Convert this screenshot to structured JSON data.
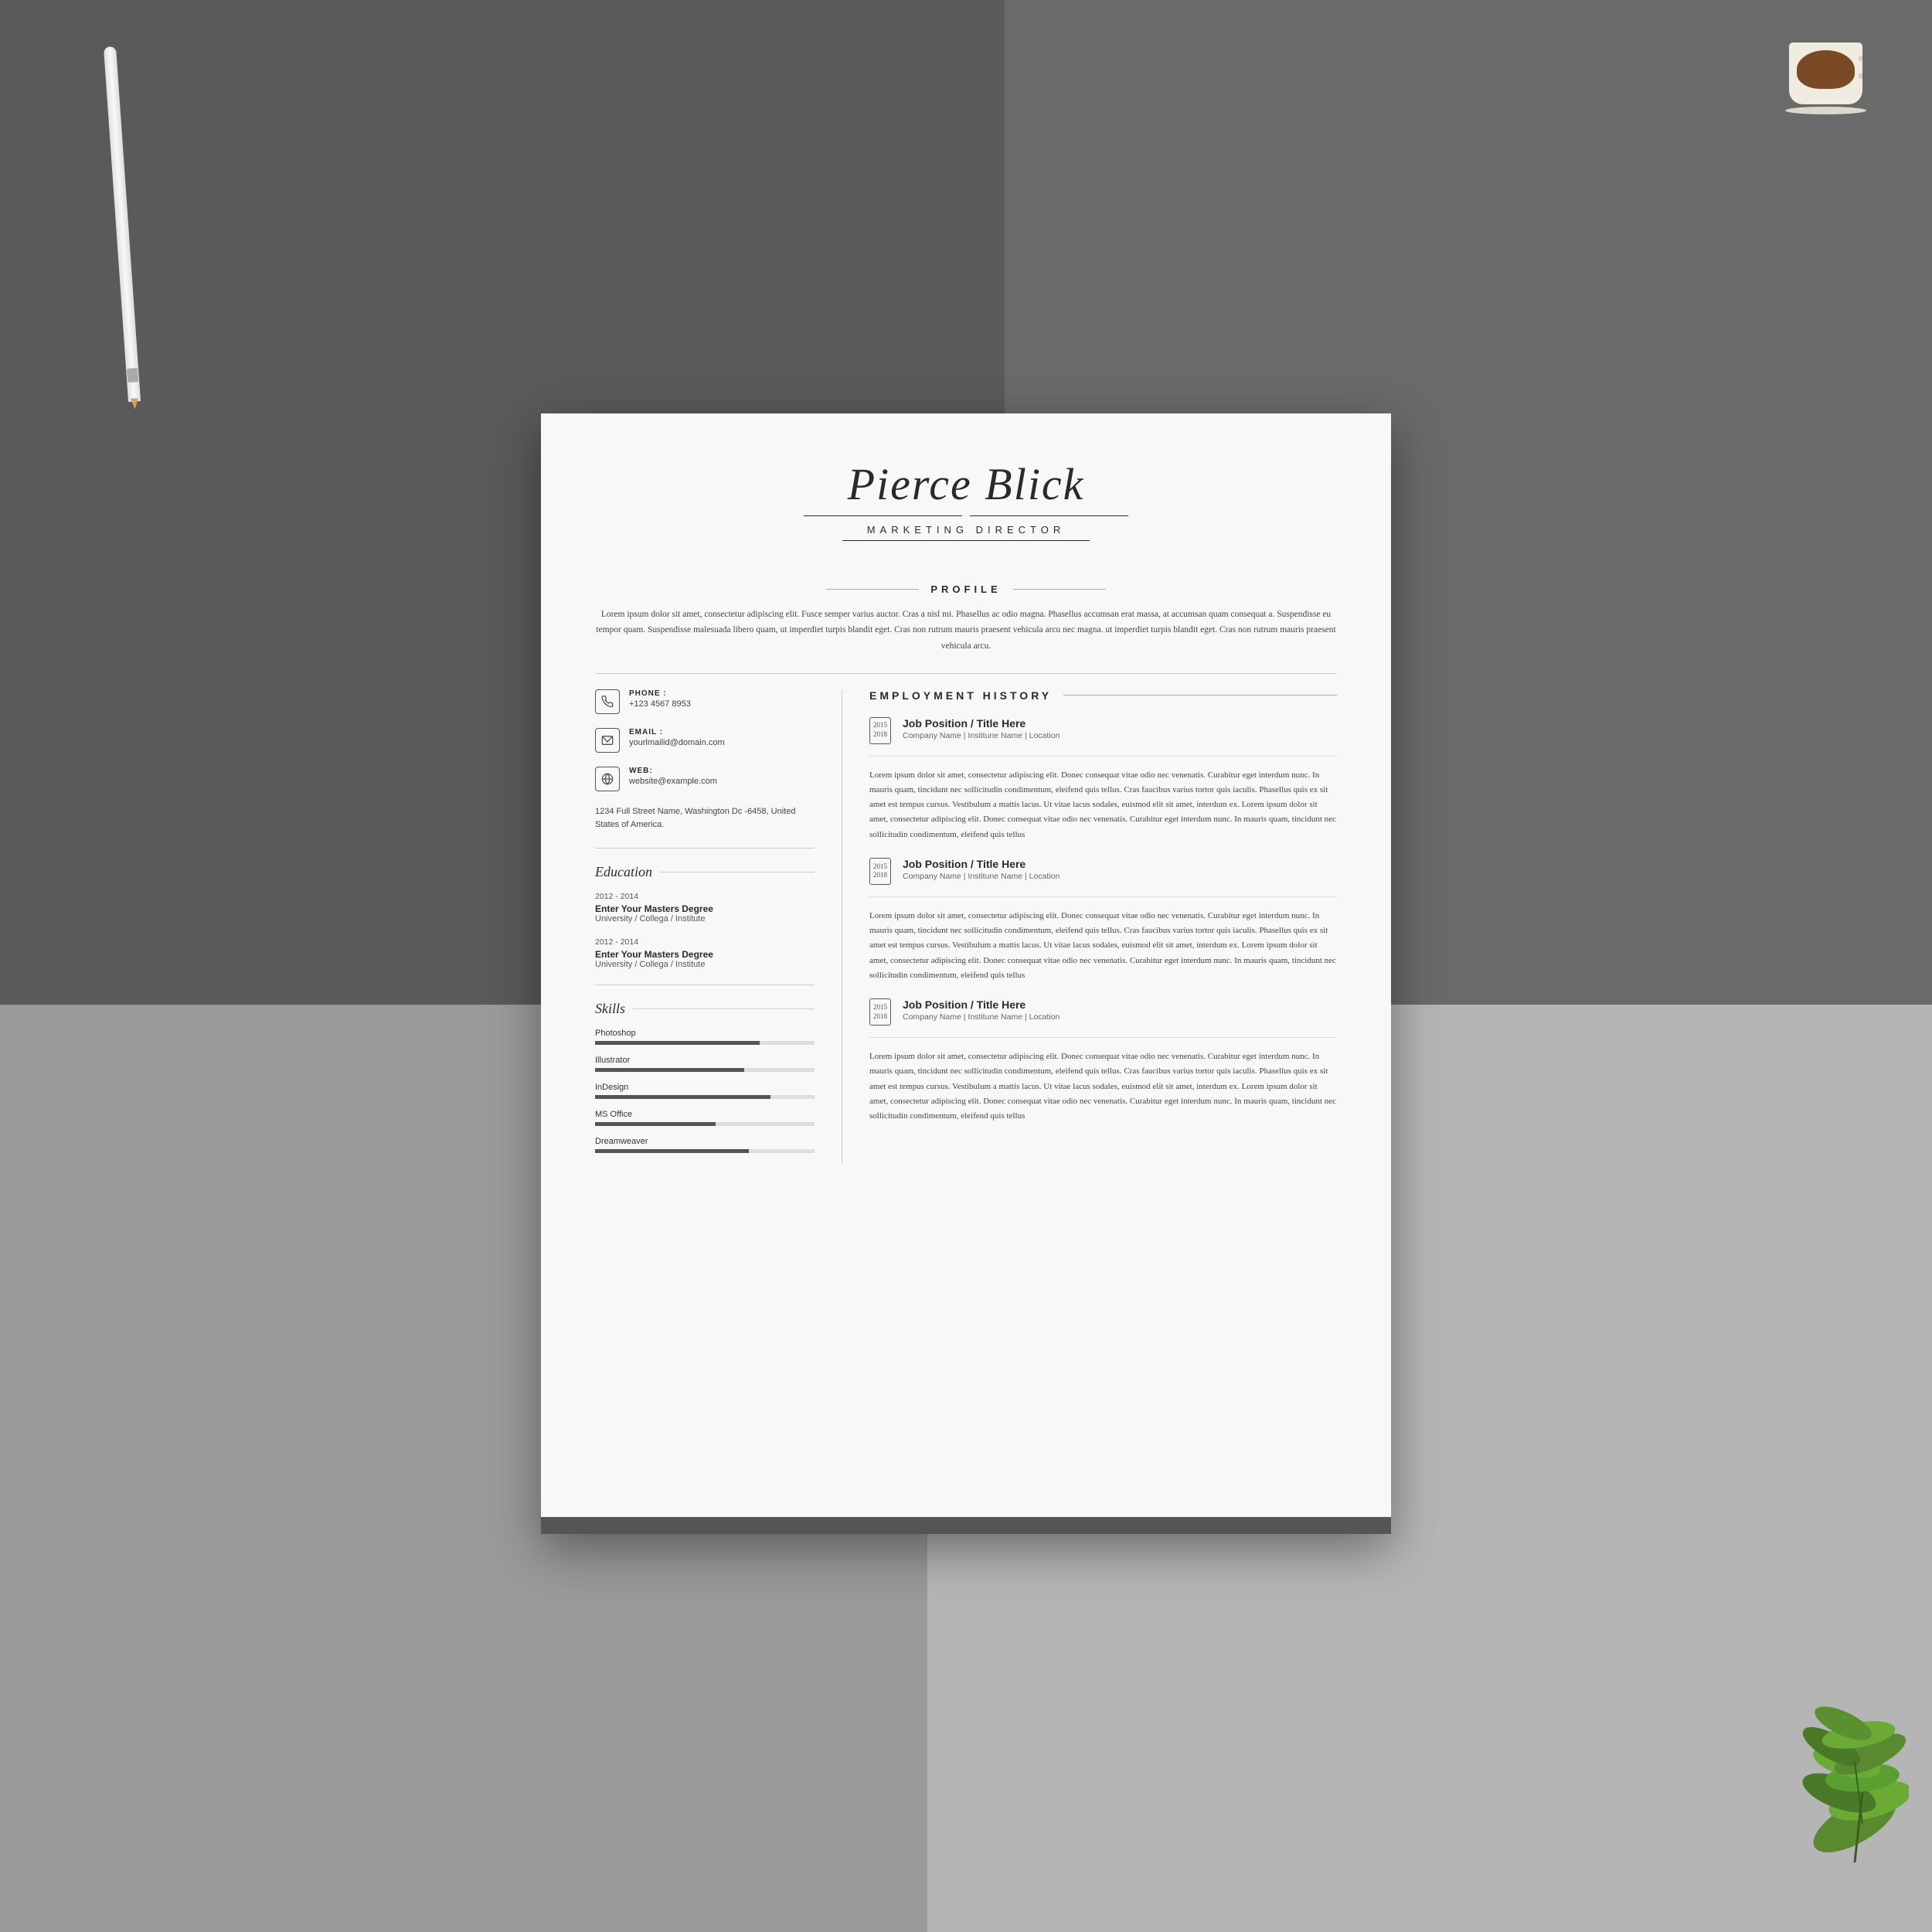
{
  "background": {
    "color_dark": "#555555",
    "color_light": "#b0b0b0"
  },
  "resume": {
    "name": "Pierce Blick",
    "title": "MARKETING DIRECTOR",
    "profile": {
      "section_label": "PROFILE",
      "text": "Lorem ipsum dolor sit amet, consectetur adipiscing elit. Fusce semper varius auctor. Cras a nisl mi. Phasellus ac odio magna. Phasellus accumsan erat massa, at accumsan quam consequat a. Suspendisse eu tempor quam. Suspendisse malesuada libero quam, ut imperdiet turpis blandit eget. Cras non rutrum mauris praesent vehicula arcu nec magna. ut imperdiet turpis blandit eget. Cras non rutrum mauris praesent vehicula arcu."
    },
    "contact": {
      "phone_label": "PHONE :",
      "phone_value": "+123 4567 8953",
      "email_label": "EMAIL :",
      "email_value": "yourlmailid@domain.com",
      "web_label": "WEB:",
      "web_value": "website@example.com",
      "address": "1234 Full Street Name, Washington Dc -6458, United States of America."
    },
    "education": {
      "section_label": "Education",
      "items": [
        {
          "years": "2012 - 2014",
          "degree": "Enter Your Masters Degree",
          "institution": "University / Collega / Institute"
        },
        {
          "years": "2012 - 2014",
          "degree": "Enter Your Masters Degree",
          "institution": "University / Collega / Institute"
        }
      ]
    },
    "skills": {
      "section_label": "Skills",
      "items": [
        {
          "name": "Photoshop",
          "percent": 75
        },
        {
          "name": "Illustrator",
          "percent": 68
        },
        {
          "name": "InDesign",
          "percent": 80
        },
        {
          "name": "MS Office",
          "percent": 55
        },
        {
          "name": "Dreamweaver",
          "percent": 70
        }
      ]
    },
    "employment": {
      "section_label": "EMPLOYMENT HISTORY",
      "jobs": [
        {
          "year_start": "2015",
          "year_end": "2018",
          "title": "Job Position / Title Here",
          "company": "Company Name | Institune Name | Location",
          "description": "Lorem ipsum dolor sit amet, consectetur adipiscing elit. Donec consequat vitae odio nec venenatis. Curabitur eget interdum nunc. In mauris quam, tincidunt nec sollicitudin condimentum, eleifend quis tellus. Cras faucibus varius tortor quis iaculis. Phasellus quis ex sit amet est tempus cursus. Vestibulum a mattis lacus. Ut vitae lacus sodales, euismod elit sit amet, interdum ex. Lorem ipsum dolor sit amet, consectetur adipiscing elit. Donec consequat vitae odio nec venenatis. Curabitur eget interdum nunc. In mauris quam, tincidunt nec sollicitudin condimentum, eleifend quis tellus"
        },
        {
          "year_start": "2015",
          "year_end": "2018",
          "title": "Job Position / Title Here",
          "company": "Company Name | Institune Name | Location",
          "description": "Lorem ipsum dolor sit amet, consectetur adipiscing elit. Donec consequat vitae odio nec venenatis. Curabitur eget interdum nunc. In mauris quam, tincidunt nec sollicitudin condimentum, eleifend quis tellus. Cras faucibus varius tortor quis iaculis. Phasellus quis ex sit amet est tempus cursus. Vestibulum a mattis lacus. Ut vitae lacus sodales, euismod elit sit amet, interdum ex. Lorem ipsum dolor sit amet, consectetur adipiscing elit. Donec consequat vitae odio nec venenatis. Curabitur eget interdum nunc. In mauris quam, tincidunt nec sollicitudin condimentum, eleifend quis tellus"
        },
        {
          "year_start": "2015",
          "year_end": "2018",
          "title": "Job Position / Title Here",
          "company": "Company Name | Institune Name | Location",
          "description": "Lorem ipsum dolor sit amet, consectetur adipiscing elit. Donec consequat vitae odio nec venenatis. Curabitur eget interdum nunc. In mauris quam, tincidunt nec sollicitudin condimentum, eleifend quis tellus. Cras faucibus varius tortor quis iaculis. Phasellus quis ex sit amet est tempus cursus. Vestibulum a mattis lacus. Ut vitae lacus sodales, euismod elit sit amet, interdum ex. Lorem ipsum dolor sit amet, consectetur adipiscing elit. Donec consequat vitae odio nec venenatis. Curabitur eget interdum nunc. In mauris quam, tincidunt nec sollicitudin condimentum, eleifend quis tellus"
        }
      ]
    }
  }
}
